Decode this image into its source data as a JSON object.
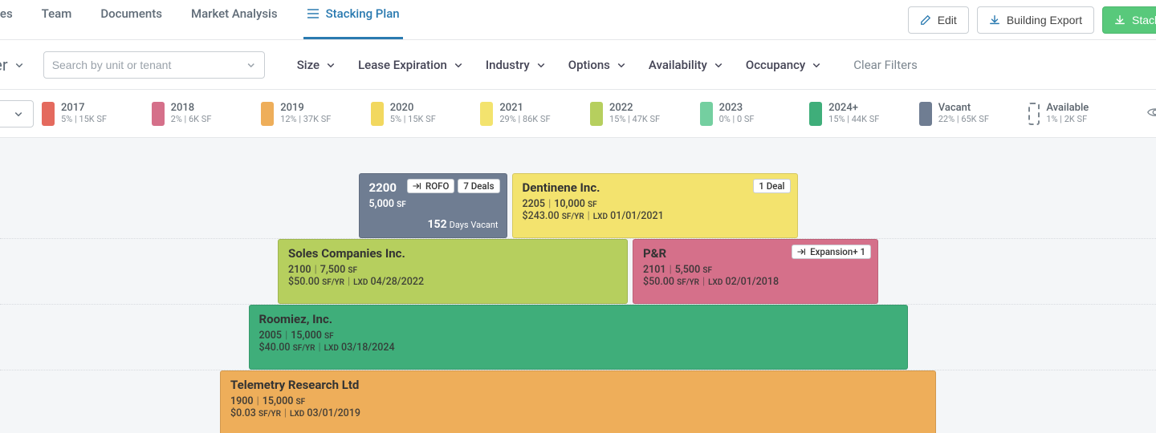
{
  "tabs": {
    "spaces": "aces",
    "team": "Team",
    "documents": "Documents",
    "market": "Market Analysis",
    "stacking": "Stacking Plan"
  },
  "actions": {
    "edit": "Edit",
    "export": "Building Export",
    "stack": "Stack"
  },
  "filterbar": {
    "building": "s Tower",
    "search_placeholder": "Search by unit or tenant",
    "size": "Size",
    "lease_exp": "Lease Expiration",
    "industry": "Industry",
    "options": "Options",
    "availability": "Availability",
    "occupancy": "Occupancy",
    "clear": "Clear Filters"
  },
  "legend": [
    {
      "label": "2017",
      "sub": "5% | 15K SF",
      "color": "#e46a5e"
    },
    {
      "label": "2018",
      "sub": "2% | 6K SF",
      "color": "#d5708a"
    },
    {
      "label": "2019",
      "sub": "12% | 37K SF",
      "color": "#eeae5a"
    },
    {
      "label": "2020",
      "sub": "5% | 15K SF",
      "color": "#f2d85f"
    },
    {
      "label": "2021",
      "sub": "29% | 86K SF",
      "color": "#f3e36e"
    },
    {
      "label": "2022",
      "sub": "15% | 47K SF",
      "color": "#b6cf5e"
    },
    {
      "label": "2023",
      "sub": "0% | 0 SF",
      "color": "#74cfa0"
    },
    {
      "label": "2024+",
      "sub": "15% | 44K SF",
      "color": "#3fae7a"
    },
    {
      "label": "Vacant",
      "sub": "22% | 65K SF",
      "color": "#6f7d92"
    },
    {
      "label": "Available",
      "sub": "1% | 2K SF",
      "dashed": true
    }
  ],
  "units": {
    "u2200": {
      "suite": "2200",
      "size": "5,000",
      "rofo": "ROFO",
      "deals": "7 Deals",
      "days_vacant": "152",
      "days_label": "Days Vacant",
      "color": "#6f7d92"
    },
    "u2205": {
      "tenant": "Dentinene Inc.",
      "suite": "2205",
      "size": "10,000",
      "rent": "$243.00",
      "lxd": "01/01/2021",
      "deals": "1 Deal",
      "color": "#f3e36e"
    },
    "u2100": {
      "tenant": "Soles Companies Inc.",
      "suite": "2100",
      "size": "7,500",
      "rent": "$50.00",
      "lxd": "04/28/2022",
      "color": "#b6cf5e"
    },
    "u2101": {
      "tenant": "P&R",
      "suite": "2101",
      "size": "5,500",
      "rent": "$50.00",
      "lxd": "02/01/2018",
      "badge": "Expansion+ 1",
      "color": "#d5708a"
    },
    "u2005": {
      "tenant": "Roomiez, Inc.",
      "suite": "2005",
      "size": "15,000",
      "rent": "$40.00",
      "lxd": "03/18/2024",
      "color": "#3fae7a"
    },
    "u1900": {
      "tenant": "Telemetry Research Ltd",
      "suite": "1900",
      "size": "15,000",
      "rent": "$0.03",
      "lxd": "03/01/2019",
      "color": "#eeae5a"
    }
  },
  "labels": {
    "sf": "SF",
    "sfyr": "SF/YR",
    "lxd": "LXD"
  }
}
